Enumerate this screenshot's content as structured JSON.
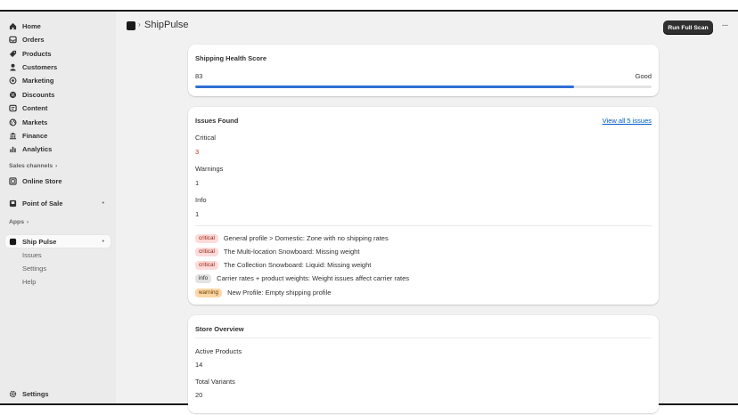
{
  "sidebar": {
    "items": [
      {
        "label": "Home",
        "icon": "home-icon"
      },
      {
        "label": "Orders",
        "icon": "inbox-icon"
      },
      {
        "label": "Products",
        "icon": "tag-icon"
      },
      {
        "label": "Customers",
        "icon": "person-icon"
      },
      {
        "label": "Marketing",
        "icon": "target-icon"
      },
      {
        "label": "Discounts",
        "icon": "discount-icon"
      },
      {
        "label": "Content",
        "icon": "content-icon"
      },
      {
        "label": "Markets",
        "icon": "globe-icon"
      },
      {
        "label": "Finance",
        "icon": "bank-icon"
      },
      {
        "label": "Analytics",
        "icon": "bar-chart-icon"
      }
    ],
    "sales_channels_label": "Sales channels",
    "online_store_label": "Online Store",
    "pos_label": "Point of Sale",
    "apps_label": "Apps",
    "app": {
      "label": "Ship Pulse",
      "subitems": [
        "Issues",
        "Settings",
        "Help"
      ]
    },
    "settings_label": "Settings"
  },
  "header": {
    "app_title": "ShipPulse",
    "breadcrumb_sep": "›",
    "scan_button": "Run Full Scan",
    "more_button": "···"
  },
  "health": {
    "title": "Shipping Health Score",
    "score": "83",
    "status": "Good",
    "progress_percent": 83
  },
  "issues": {
    "title": "Issues Found",
    "view_all": "View all 5 issues",
    "counts": [
      {
        "label": "Critical",
        "value": "3",
        "color": "#c22f1b"
      },
      {
        "label": "Warnings",
        "value": "1",
        "color": "#303030"
      },
      {
        "label": "Info",
        "value": "1",
        "color": "#303030"
      }
    ],
    "list": [
      {
        "badge": "critical",
        "text": "General profile > Domestic: Zone with no shipping rates"
      },
      {
        "badge": "critical",
        "text": "The Multi-location Snowboard: Missing weight"
      },
      {
        "badge": "critical",
        "text": "The Collection Snowboard: Liquid: Missing weight"
      },
      {
        "badge": "info",
        "text": "Carrier rates + product weights: Weight issues affect carrier rates"
      },
      {
        "badge": "warning",
        "text": "New Profile: Empty shipping profile"
      }
    ]
  },
  "overview": {
    "title": "Store Overview",
    "stats": [
      {
        "label": "Active Products",
        "value": "14"
      },
      {
        "label": "Total Variants",
        "value": "20"
      }
    ]
  }
}
